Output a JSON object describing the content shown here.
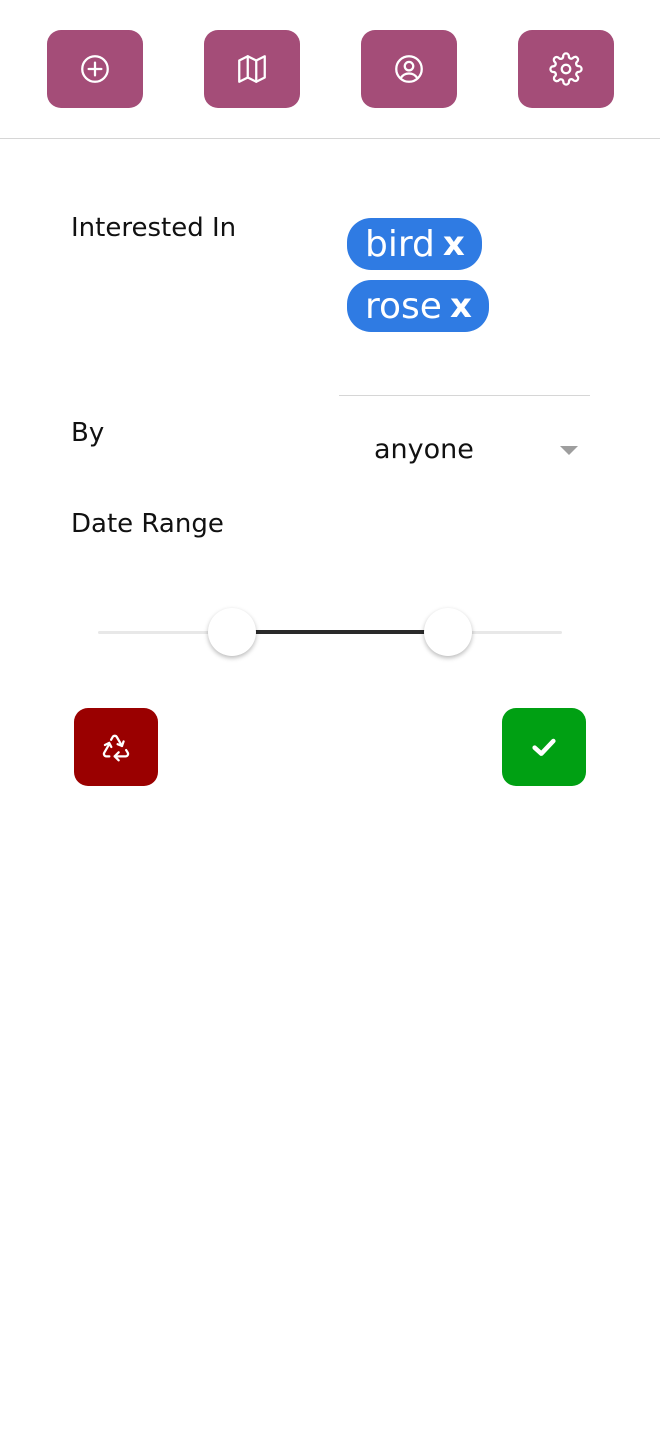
{
  "toolbar": {
    "buttons": [
      {
        "icon": "add-circle-icon"
      },
      {
        "icon": "map-icon"
      },
      {
        "icon": "user-circle-icon"
      },
      {
        "icon": "gear-icon"
      }
    ],
    "button_color": "#a44d78"
  },
  "filter": {
    "interested_label": "Interested In",
    "chips": [
      {
        "label": "bird",
        "remove": "x"
      },
      {
        "label": "rose",
        "remove": "x"
      }
    ],
    "chip_color": "#2f7be3",
    "by_label": "By",
    "by_value": "anyone",
    "date_label": "Date Range",
    "date_range": {
      "low_fraction": 0.288,
      "high_fraction": 0.754
    }
  },
  "actions": {
    "reset_icon": "recycle-icon",
    "reset_color": "#9a0000",
    "apply_icon": "check-icon",
    "apply_color": "#00a013"
  }
}
